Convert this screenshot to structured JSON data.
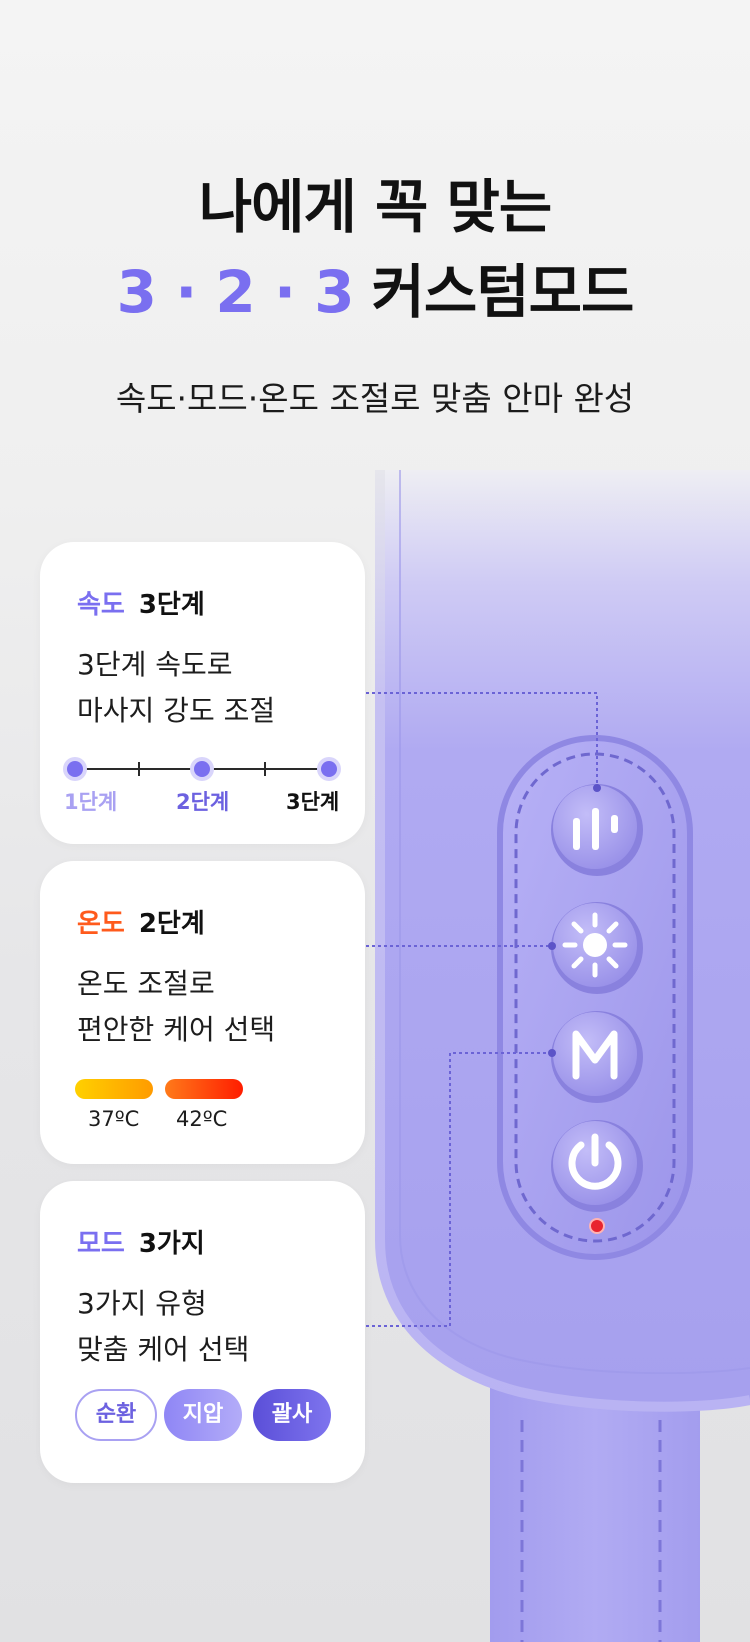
{
  "headline": {
    "line1": "나에게 꼭 맞는",
    "line2_accent": "3 · 2 · 3",
    "line2_rest": "커스텀모드"
  },
  "subtitle": "속도·모드·온도 조절로 맞춤 안마 완성",
  "cards": {
    "speed": {
      "category": "속도",
      "value": "3단계",
      "desc_line1": "3단계 속도로",
      "desc_line2": "마사지 강도 조절",
      "levels": [
        "1단계",
        "2단계",
        "3단계"
      ]
    },
    "temperature": {
      "category": "온도",
      "value": "2단계",
      "desc_line1": "온도 조절로",
      "desc_line2": "편안한 케어 선택",
      "temps": [
        "37ºC",
        "42ºC"
      ]
    },
    "mode": {
      "category": "모드",
      "value": "3가지",
      "desc_line1": "3가지 유형",
      "desc_line2": "맞춤 케어 선택",
      "modes": [
        "순환",
        "지압",
        "괄사"
      ]
    }
  },
  "colors": {
    "accent": "#7a6ff0",
    "temp": "#ff5a1c",
    "device": "#a7a2f0",
    "indicator": "#e8242e"
  },
  "device_buttons": [
    "speed-icon",
    "sun-icon",
    "mode-m-icon",
    "power-icon"
  ]
}
